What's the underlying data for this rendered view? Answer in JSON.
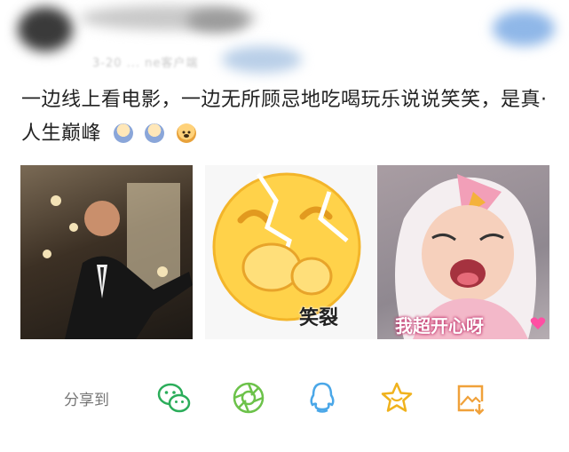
{
  "header": {
    "meta_text": "3-20 ... ne客户端"
  },
  "post": {
    "text": "一边线上看电影，一边无所顾忌地吃喝玩乐说说笑笑，是真·人生巅峰",
    "emojis": [
      "baby-icon",
      "baby-icon",
      "doge-icon"
    ]
  },
  "photos": [
    {
      "icon": "man-in-suit-photo",
      "caption": ""
    },
    {
      "icon": "laughing-face-sticker",
      "caption": "笑裂"
    },
    {
      "icon": "crying-baby-photo",
      "caption": "我超开心呀"
    }
  ],
  "share": {
    "label": "分享到",
    "targets": [
      {
        "name": "wechat",
        "icon": "wechat-icon",
        "color": "#2bad5a"
      },
      {
        "name": "moments",
        "icon": "moments-icon",
        "color": "#6cc24a"
      },
      {
        "name": "qq",
        "icon": "qq-icon",
        "color": "#4aa7e8"
      },
      {
        "name": "favorite",
        "icon": "star-icon",
        "color": "#f0b21d"
      },
      {
        "name": "save-image",
        "icon": "save-image-icon",
        "color": "#f0a13a"
      }
    ]
  }
}
